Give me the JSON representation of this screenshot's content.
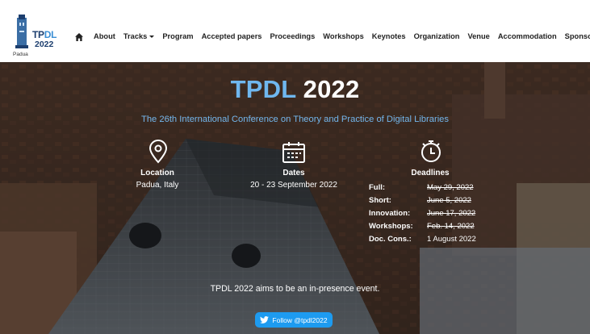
{
  "header": {
    "logo": {
      "acronym_a": "TP",
      "acronym_b": "DL",
      "year": "2022",
      "city": "Padua"
    },
    "nav": [
      {
        "label": "About",
        "dropdown": false
      },
      {
        "label": "Tracks",
        "dropdown": true
      },
      {
        "label": "Program",
        "dropdown": false
      },
      {
        "label": "Accepted papers",
        "dropdown": false
      },
      {
        "label": "Proceedings",
        "dropdown": false
      },
      {
        "label": "Workshops",
        "dropdown": false
      },
      {
        "label": "Keynotes",
        "dropdown": false
      },
      {
        "label": "Organization",
        "dropdown": false
      },
      {
        "label": "Venue",
        "dropdown": false
      },
      {
        "label": "Accommodation",
        "dropdown": false
      },
      {
        "label": "Sponsors",
        "dropdown": false
      }
    ]
  },
  "hero": {
    "title_acronym": "TPDL",
    "title_year": "2022",
    "subtitle": "The 26th International Conference on Theory and Practice of Digital Libraries",
    "location": {
      "heading": "Location",
      "value": "Padua, Italy"
    },
    "dates": {
      "heading": "Dates",
      "value": "20 - 23 September 2022"
    },
    "deadlines": {
      "heading": "Deadlines",
      "rows": [
        {
          "key": "Full:",
          "value": "May 29, 2022",
          "struck": true
        },
        {
          "key": "Short:",
          "value": "June 5, 2022",
          "struck": true
        },
        {
          "key": "Innovation:",
          "value": "June 17, 2022",
          "struck": true
        },
        {
          "key": "Workshops:",
          "value": "Feb. 14, 2022",
          "struck": true
        },
        {
          "key": "Doc. Cons.:",
          "value": "1 August 2022",
          "struck": false
        }
      ]
    },
    "presence": "TPDL 2022 aims to be an in-presence event.",
    "follow_label": "Follow @tpdl2022"
  },
  "colors": {
    "accent": "#6fb7ef",
    "nav_active": "#2e7bc4",
    "twitter": "#1d9bf0"
  }
}
